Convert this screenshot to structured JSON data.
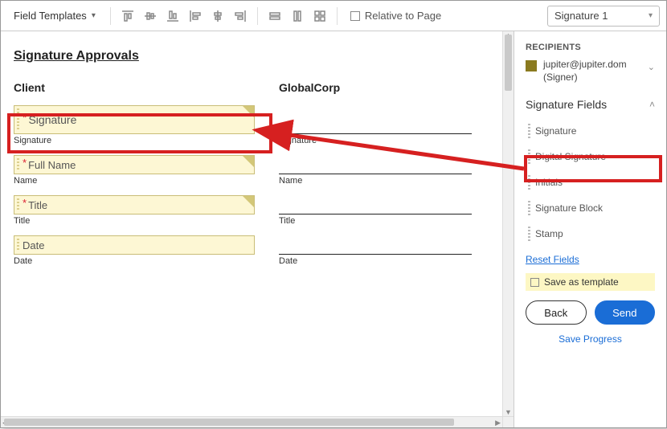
{
  "toolbar": {
    "field_templates_label": "Field Templates",
    "relative_to_page_label": "Relative to Page",
    "signer_select_value": "Signature 1"
  },
  "document": {
    "title": "Signature Approvals",
    "columns": [
      {
        "heading": "Client",
        "fields": [
          {
            "placeholder": "Signature",
            "label": "Signature",
            "required": true,
            "big": true,
            "editable": true
          },
          {
            "placeholder": "Full Name",
            "label": "Name",
            "required": true,
            "big": false,
            "editable": true
          },
          {
            "placeholder": "Title",
            "label": "Title",
            "required": true,
            "big": false,
            "editable": true
          },
          {
            "placeholder": "Date",
            "label": "Date",
            "required": false,
            "big": false,
            "editable": true
          }
        ]
      },
      {
        "heading": "GlobalCorp",
        "fields": [
          {
            "label": "Signature",
            "editable": false
          },
          {
            "label": "Name",
            "editable": false
          },
          {
            "label": "Title",
            "editable": false
          },
          {
            "label": "Date",
            "editable": false
          }
        ]
      }
    ]
  },
  "panel": {
    "recipients_heading": "RECIPIENTS",
    "recipient_email": "jupiter@jupiter.dom",
    "recipient_role": "(Signer)",
    "signature_fields_heading": "Signature Fields",
    "signature_fields": [
      "Signature",
      "Digital Signature",
      "Initials",
      "Signature Block",
      "Stamp"
    ],
    "reset_fields_label": "Reset Fields",
    "save_as_template_label": "Save as template",
    "back_label": "Back",
    "send_label": "Send",
    "save_progress_label": "Save Progress"
  }
}
